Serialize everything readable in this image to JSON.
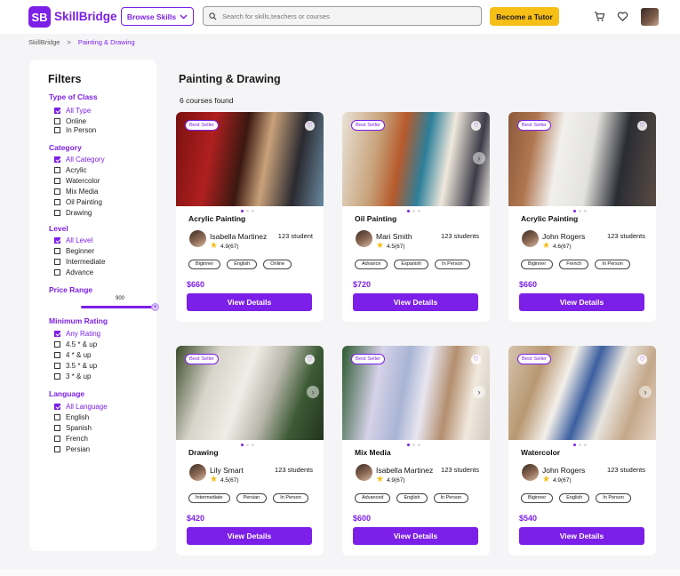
{
  "header": {
    "logo_mark": "SB",
    "logo_text": "SkillBridge",
    "browse_label": "Browse Skills",
    "search_placeholder": "Search for skills,teachers or courses",
    "tutor_label": "Become a Tutor"
  },
  "breadcrumb": {
    "home": "SkillBridge",
    "separator": ">",
    "current": "Painting & Drawing"
  },
  "filters": {
    "title": "Filters",
    "type_title": "Type of Class",
    "type": [
      "All Type",
      "Online",
      "In Person"
    ],
    "category_title": "Category",
    "category": [
      "All Category",
      "Acrylic",
      "Watercolor",
      "Mix Media",
      "Oil Painting",
      "Drawing"
    ],
    "level_title": "Level",
    "level": [
      "All Level",
      "Beginner",
      "Intermediate",
      "Advance"
    ],
    "price_title": "Price Range",
    "price_value": "900",
    "price_fraction": 0.95,
    "rating_title": "Minimum Rating",
    "rating": [
      "Any Rating",
      "4.5 *  & up",
      "4 * & up",
      "3.5 * & up",
      "3 * & up"
    ],
    "language_title": "Language",
    "language": [
      "All Language",
      "English",
      "Spanish",
      "French",
      "Persian"
    ]
  },
  "main": {
    "title": "Painting & Drawing",
    "found": "6 courses found"
  },
  "cards": [
    {
      "badge": "Best Seller",
      "title": "Acrylic Painting",
      "teacher": "Isabella Martinez",
      "students": "123 student",
      "rating": "4.9(67)",
      "tags": [
        "Biginner",
        "English",
        "Online"
      ],
      "price": "$660",
      "button": "View Details"
    },
    {
      "badge": "Best Seller",
      "title": "Oil Painting",
      "teacher": "Mari Smith",
      "students": "123 students",
      "rating": "4.5(67)",
      "tags": [
        "Advance",
        "Espanish",
        "In Person"
      ],
      "price": "$720",
      "button": "View Details"
    },
    {
      "badge": "Best Seller",
      "title": "Acrylic Painting",
      "teacher": "John Rogers",
      "students": "123 students",
      "rating": "4.6(67)",
      "tags": [
        "Biginner",
        "French",
        "In Person"
      ],
      "price": "$660",
      "button": "View Details"
    },
    {
      "badge": "Best Seller",
      "title": "Drawing",
      "teacher": "Lily Smart",
      "students": "123 students",
      "rating": "4.5(67)",
      "tags": [
        "Intermediate",
        "Persian",
        "In Person"
      ],
      "price": "$420",
      "button": "View Details"
    },
    {
      "badge": "Best Seller",
      "title": "Mix Media",
      "teacher": "Isabella Martinez",
      "students": "123 students",
      "rating": "4.9(67)",
      "tags": [
        "Advanced",
        "English",
        "In Person"
      ],
      "price": "$600",
      "button": "View Details"
    },
    {
      "badge": "Best Seller",
      "title": "Watercolor",
      "teacher": "John Rogers",
      "students": "123 students",
      "rating": "4.9(67)",
      "tags": [
        "Biginner",
        "English",
        "In Person"
      ],
      "price": "$540",
      "button": "View Details"
    }
  ],
  "colors": {
    "accent": "#7c1fe8",
    "cta": "#f7be16"
  },
  "icons": {
    "search": "search-icon",
    "cart": "cart-icon",
    "heart": "heart-icon",
    "chevron": "chevron-down-icon"
  }
}
